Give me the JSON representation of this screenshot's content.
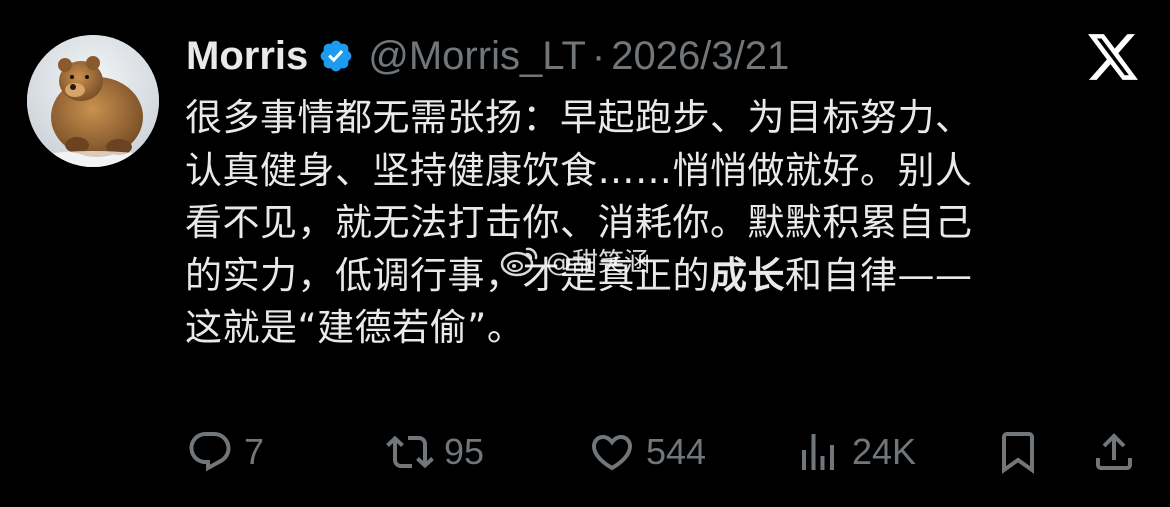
{
  "author": {
    "name": "Morris",
    "handle": "@Morris_LT",
    "separator": "·",
    "date": "2026/3/21",
    "avatar_icon": "bear-avatar",
    "verified_color": "#1d9bf0"
  },
  "platform_icon": "x-logo",
  "tweet": {
    "lines": [
      "很多事情都无需张扬：早起跑步、为目标努力、",
      "认真健身、坚持健康饮食……悄悄做就好。别人",
      "看不见，就无法打击你、消耗你。默默积累自己"
    ],
    "line4_before": "的实力，低调行事，才是真正的",
    "line4_bold": "成长",
    "line4_after": "和自律——",
    "line5": "这就是“建德若偷”。"
  },
  "watermark": {
    "text": "@甜笑涵",
    "icon": "weibo-icon"
  },
  "actions": {
    "reply_count": "7",
    "retweet_count": "95",
    "like_count": "544",
    "views_count": "24K"
  },
  "colors": {
    "background": "#000000",
    "text": "#e7e9ea",
    "secondary": "#71767b",
    "verified": "#1d9bf0"
  }
}
